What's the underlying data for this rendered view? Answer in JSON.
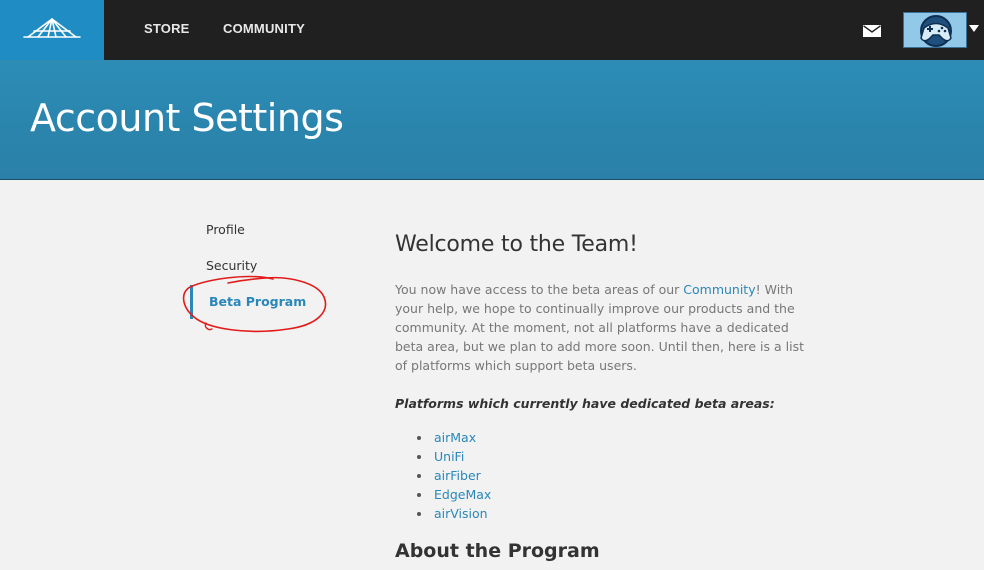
{
  "nav": {
    "items": [
      {
        "label": "STORE"
      },
      {
        "label": "COMMUNITY"
      }
    ],
    "icons": {
      "logo": "ubiquiti-logo-icon",
      "mail": "mail-icon",
      "avatar": "gamepad-avatar-icon",
      "caret": "caret-down-icon"
    }
  },
  "hero": {
    "title": "Account Settings"
  },
  "sidebar": {
    "items": [
      {
        "label": "Profile"
      },
      {
        "label": "Security"
      },
      {
        "label": "Beta Program",
        "active": true
      }
    ]
  },
  "content": {
    "title": "Welcome to the Team!",
    "intro_before": "You now have access to the beta areas of our ",
    "intro_link": "Community",
    "intro_after": "! With your help, we hope to continually improve our products and the community. At the moment, not all platforms have a dedicated beta area, but we plan to add more soon. Until then, here is a list of platforms which support beta users.",
    "platforms_heading": "Platforms which currently have dedicated beta areas:",
    "platforms": [
      "airMax",
      "UniFi",
      "airFiber",
      "EdgeMax",
      "airVision"
    ],
    "about_title": "About the Program"
  },
  "colors": {
    "accent": "#2a87b9",
    "topbar": "#202020",
    "logo_bg": "#1f8dc4",
    "hero": "#2a85ad",
    "annotation": "#e21b1b"
  }
}
